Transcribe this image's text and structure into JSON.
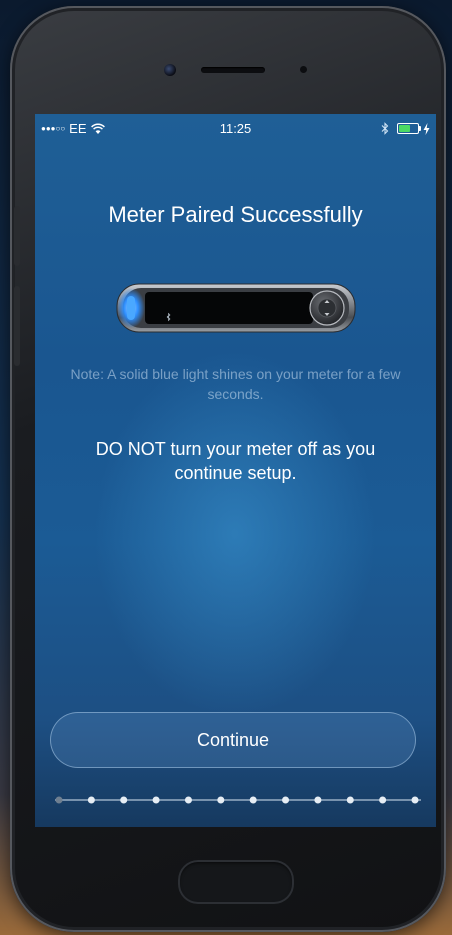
{
  "status_bar": {
    "carrier": "EE",
    "time": "11:25",
    "battery_level_pct": 60
  },
  "screen": {
    "title": "Meter Paired Successfully",
    "note": "Note: A solid blue light shines on your meter for a few seconds.",
    "warning": "DO NOT turn your meter off as you continue setup.",
    "continue_label": "Continue"
  },
  "progress": {
    "total_steps": 12,
    "current_step": 1
  },
  "colors": {
    "screen_bg": "#1d5a94",
    "battery_green": "#4cd964",
    "meter_light": "#3aa0ff"
  }
}
